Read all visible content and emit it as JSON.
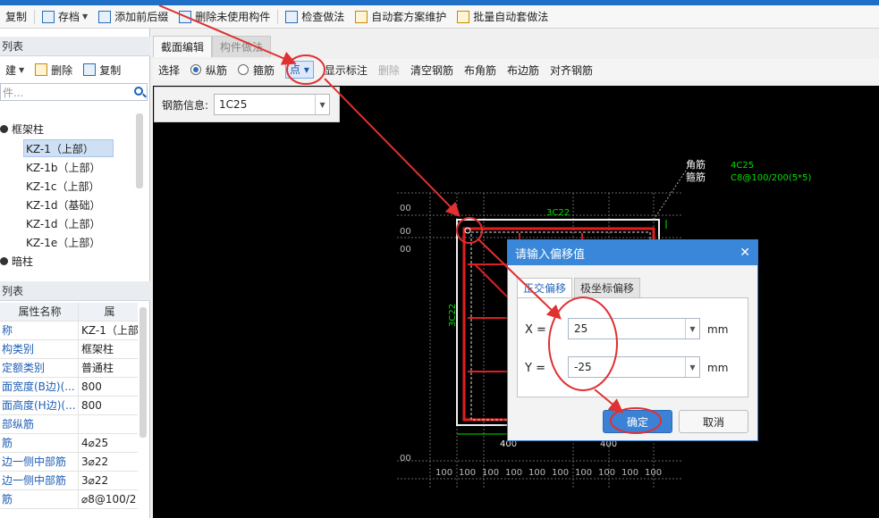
{
  "toolbar": {
    "items": [
      "复制",
      "存档",
      "添加前后缀",
      "删除未使用构件",
      "检查做法",
      "自动套方案维护",
      "批量自动套做法"
    ]
  },
  "left_panel": {
    "component_list_title": "列表",
    "new_label": "建",
    "delete_label": "删除",
    "copy_label": "复制",
    "search_placeholder": "件...",
    "tree_root": "框架柱",
    "tree_items": [
      "KZ-1（上部）",
      "KZ-1b（上部）",
      "KZ-1c（上部）",
      "KZ-1d（基础）",
      "KZ-1d（上部）",
      "KZ-1e（上部）"
    ],
    "tree_other": "暗柱",
    "prop_list_title": "列表",
    "prop_header_name": "属性名称",
    "prop_header_value": "属",
    "props": [
      {
        "k": "称",
        "v": "KZ-1（上部"
      },
      {
        "k": "构类别",
        "v": "框架柱"
      },
      {
        "k": "定额类别",
        "v": "普通柱"
      },
      {
        "k": "面宽度(B边)(...",
        "v": "800"
      },
      {
        "k": "面高度(H边)(...",
        "v": "800"
      },
      {
        "k": "部纵筋",
        "v": ""
      },
      {
        "k": "筋",
        "v": "4⌀25"
      },
      {
        "k": "边一侧中部筋",
        "v": "3⌀22"
      },
      {
        "k": "边一侧中部筋",
        "v": "3⌀22"
      },
      {
        "k": "筋",
        "v": "⌀8@100/2"
      }
    ]
  },
  "editor": {
    "tab_active": "截面编辑",
    "tab_inactive": "构件做法",
    "tools": {
      "select": "选择",
      "longitudinal": "纵筋",
      "stirrup": "箍筋",
      "point": "点",
      "show_annot": "显示标注",
      "delete": "删除",
      "clear": "清空钢筋",
      "corner": "布角筋",
      "edge": "布边筋",
      "align": "对齐钢筋"
    },
    "rebar_info_label": "钢筋信息:",
    "rebar_info_value": "1C25"
  },
  "drawing": {
    "corner_label": "角筋",
    "corner_value": "4C25",
    "stirrup_label": "箍筋",
    "stirrup_value": "C8@100/200(5*5)",
    "top_rebar": "3C22",
    "left_rebar": "3C22",
    "dim_400": "400",
    "dim_100": "100",
    "dim_00": "00"
  },
  "dialog": {
    "title": "请输入偏移值",
    "tab_ortho": "正交偏移",
    "tab_polar": "极坐标偏移",
    "x_label": "X =",
    "x_value": "25",
    "y_label": "Y =",
    "y_value": "-25",
    "unit": "mm",
    "ok": "确定",
    "cancel": "取消"
  }
}
